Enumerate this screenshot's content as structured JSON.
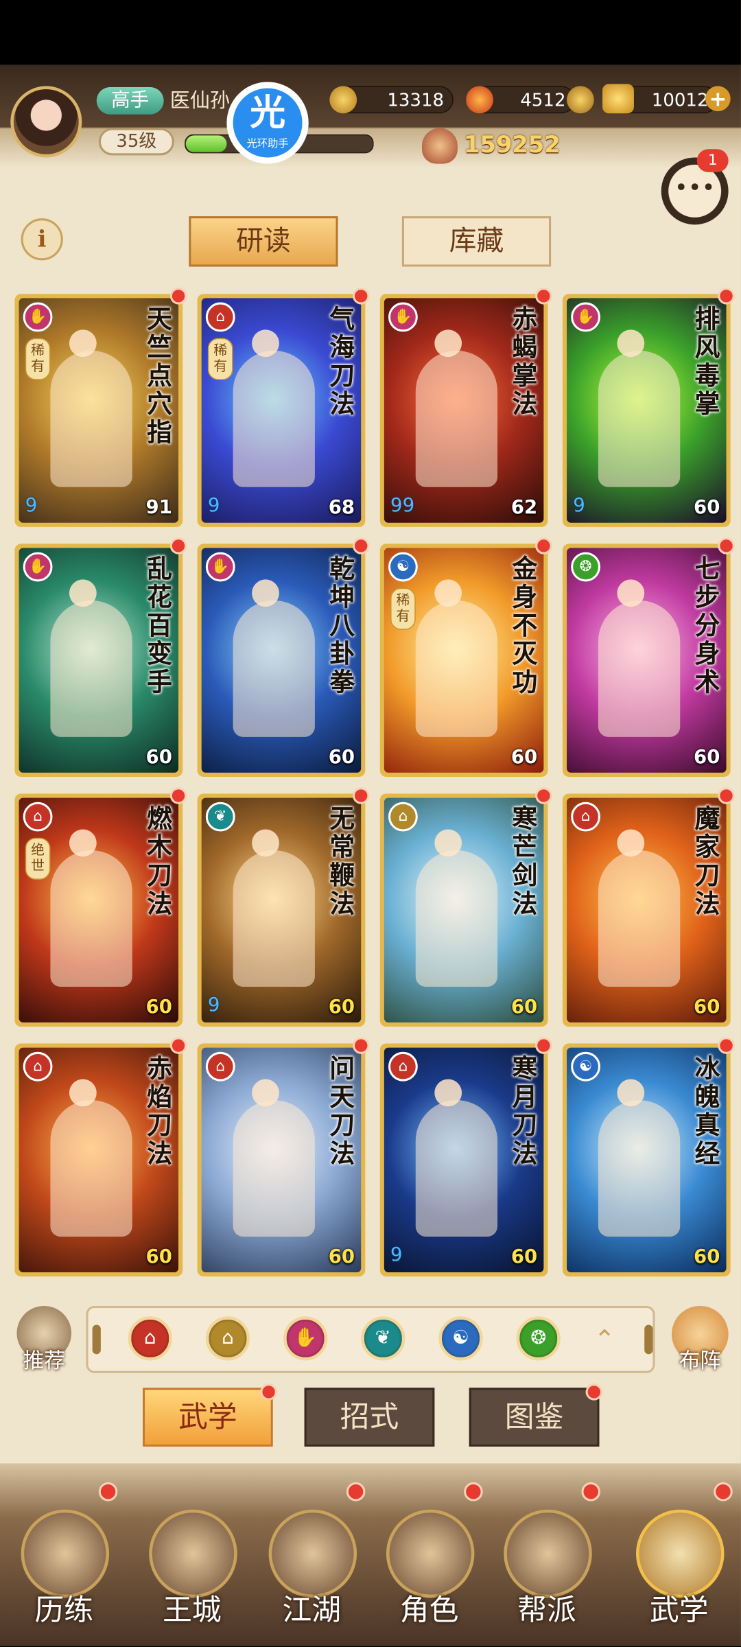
{
  "header": {
    "rank": "高手",
    "player_name": "医仙孙",
    "level": "35级",
    "exp_fraction": 0.22,
    "helper_glyph": "光",
    "helper_label": "光环助手",
    "coins": "13318",
    "fire": "4512",
    "gold": "10012",
    "add_symbol": "+",
    "power": "159252",
    "chat_badge": "1"
  },
  "top_tabs": {
    "info": "i",
    "study": "研读",
    "storage": "库藏"
  },
  "cards": [
    {
      "name": "天竺点穴指",
      "level": "91",
      "school": "fist",
      "school_color": "#c0356b",
      "rarity": "稀有",
      "drops": "9",
      "art": [
        "#f7d55a",
        "#b07a2a",
        "#3a2a1a"
      ],
      "gold": false
    },
    {
      "name": "气海刀法",
      "level": "68",
      "school": "blade",
      "school_color": "#c43326",
      "rarity": "稀有",
      "drops": "9",
      "art": [
        "#6ac9ff",
        "#3a4ad2",
        "#1a1a5a"
      ],
      "gold": false
    },
    {
      "name": "赤蝎掌法",
      "level": "62",
      "school": "fist",
      "school_color": "#c0356b",
      "rarity": "",
      "drops": "99",
      "art": [
        "#ff6a3a",
        "#a0281a",
        "#2a0c08"
      ],
      "gold": false
    },
    {
      "name": "排风毒掌",
      "level": "60",
      "school": "fist",
      "school_color": "#c0356b",
      "rarity": "",
      "drops": "9",
      "art": [
        "#b6ff3a",
        "#3aa02a",
        "#1a0a2a"
      ],
      "gold": false
    },
    {
      "name": "乱花百变手",
      "level": "60",
      "school": "fist",
      "school_color": "#c0356b",
      "rarity": "",
      "drops": "",
      "art": [
        "#bfe9d6",
        "#2a8a6a",
        "#0e2a22"
      ],
      "gold": false
    },
    {
      "name": "乾坤八卦拳",
      "level": "60",
      "school": "fist",
      "school_color": "#c0356b",
      "rarity": "",
      "drops": "",
      "art": [
        "#8ad2ff",
        "#2a5ab8",
        "#0a1a3a"
      ],
      "gold": false
    },
    {
      "name": "金身不灭功",
      "level": "60",
      "school": "inner",
      "school_color": "#2a6bc0",
      "rarity": "稀有",
      "drops": "",
      "art": [
        "#fff2a0",
        "#f29a2a",
        "#8a1a0a"
      ],
      "gold": false
    },
    {
      "name": "七步分身术",
      "level": "60",
      "school": "body",
      "school_color": "#3aa02a",
      "rarity": "",
      "drops": "",
      "art": [
        "#ffb6e8",
        "#c03aa0",
        "#3a0a2a"
      ],
      "gold": false
    },
    {
      "name": "燃木刀法",
      "level": "60",
      "school": "blade",
      "school_color": "#c43326",
      "rarity": "绝世",
      "drops": "",
      "art": [
        "#ffc24a",
        "#c0381a",
        "#2a0a08"
      ],
      "gold": true
    },
    {
      "name": "无常鞭法",
      "level": "60",
      "school": "whip",
      "school_color": "#1a8a8a",
      "rarity": "",
      "drops": "9",
      "art": [
        "#ffd98a",
        "#a0682a",
        "#2a1a0a"
      ],
      "gold": true
    },
    {
      "name": "寒芒剑法",
      "level": "60",
      "school": "sword",
      "school_color": "#b08a2a",
      "rarity": "",
      "drops": "",
      "art": [
        "#e8f6ff",
        "#6ab0d2",
        "#2a4a3a"
      ],
      "gold": true
    },
    {
      "name": "魔家刀法",
      "level": "60",
      "school": "blade",
      "school_color": "#c43326",
      "rarity": "",
      "drops": "",
      "art": [
        "#ffc24a",
        "#e0621a",
        "#5a1a0a"
      ],
      "gold": true
    },
    {
      "name": "赤焰刀法",
      "level": "60",
      "school": "blade",
      "school_color": "#c43326",
      "rarity": "",
      "drops": "",
      "art": [
        "#ffb04a",
        "#c0481a",
        "#3a120a"
      ],
      "gold": true
    },
    {
      "name": "问天刀法",
      "level": "60",
      "school": "blade",
      "school_color": "#c43326",
      "rarity": "",
      "drops": "",
      "art": [
        "#e8f0ff",
        "#8aa8d2",
        "#2a3a5a"
      ],
      "gold": true
    },
    {
      "name": "寒月刀法",
      "level": "60",
      "school": "blade",
      "school_color": "#c43326",
      "rarity": "",
      "drops": "9",
      "art": [
        "#7ac0ff",
        "#1a3a8a",
        "#08122a"
      ],
      "gold": true
    },
    {
      "name": "冰魄真经",
      "level": "60",
      "school": "inner",
      "school_color": "#2a6bc0",
      "rarity": "",
      "drops": "",
      "art": [
        "#d2f0ff",
        "#3a8ad2",
        "#0a2a5a"
      ],
      "gold": true
    }
  ],
  "filter_bar": {
    "recommend_label": "推荐",
    "formation_label": "布阵",
    "collapse_symbol": "⌃",
    "filters": [
      {
        "name": "blade",
        "color": "#c43326",
        "glyph": "⌂"
      },
      {
        "name": "sword",
        "color": "#b08a2a",
        "glyph": "⌂"
      },
      {
        "name": "fist",
        "color": "#c0356b",
        "glyph": "✋"
      },
      {
        "name": "whip",
        "color": "#1a8a8a",
        "glyph": "❦"
      },
      {
        "name": "inner",
        "color": "#2a6bc0",
        "glyph": "☯"
      },
      {
        "name": "body",
        "color": "#3aa02a",
        "glyph": "❂"
      }
    ]
  },
  "mid_tabs": {
    "martial": "武学",
    "moves": "招式",
    "atlas": "图鉴"
  },
  "bottom_nav": [
    {
      "label": "历练",
      "dot": true
    },
    {
      "label": "王城",
      "dot": false
    },
    {
      "label": "江湖",
      "dot": true
    },
    {
      "label": "角色",
      "dot": true
    },
    {
      "label": "帮派",
      "dot": true
    },
    {
      "label": "武学",
      "dot": true
    }
  ]
}
